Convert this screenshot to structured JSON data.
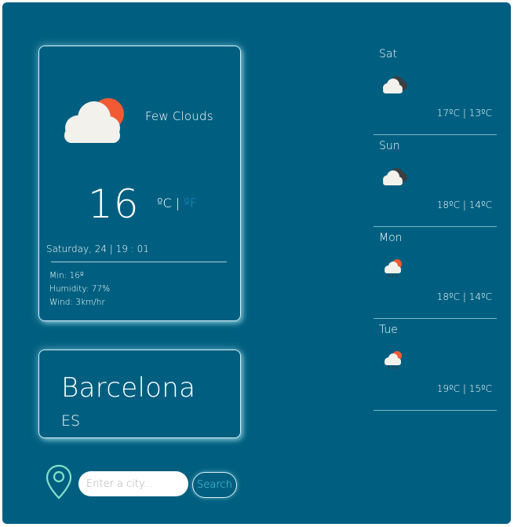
{
  "current": {
    "condition": "Few Clouds",
    "temperature": "16",
    "unit_c": "ºC",
    "unit_sep": " | ",
    "unit_f": "ºF",
    "datetime": "Saturday, 24 | 19 : 01",
    "min": "Min: 16º",
    "humidity": "Humidity: 77%",
    "wind": "Wind: 3km/hr",
    "icon": "few-clouds-day-icon"
  },
  "location": {
    "city": "Barcelona",
    "country": "ES"
  },
  "search": {
    "placeholder": "Enter a city...",
    "button_label": "Search"
  },
  "forecast": [
    {
      "day": "Sat",
      "range": "17ºC | 13ºC",
      "icon": "broken-clouds-icon"
    },
    {
      "day": "Sun",
      "range": "18ºC | 14ºC",
      "icon": "broken-clouds-icon"
    },
    {
      "day": "Mon",
      "range": "18ºC | 14ºC",
      "icon": "rain-cloud-icon"
    },
    {
      "day": "Tue",
      "range": "19ºC | 15ºC",
      "icon": "rain-cloud-icon"
    }
  ],
  "colors": {
    "background": "#005f80",
    "accent": "#60d9e0",
    "fahrenheit": "#1f8fcc",
    "sun": "#f25a34"
  }
}
